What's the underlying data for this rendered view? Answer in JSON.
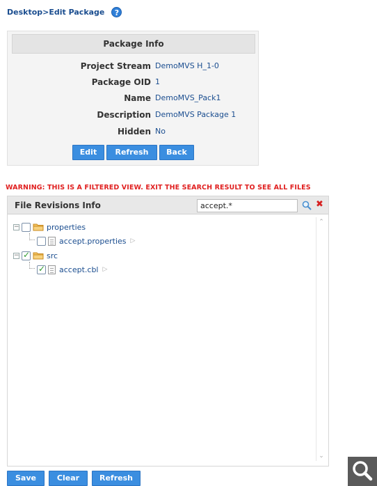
{
  "breadcrumb": "Desktop>Edit Package",
  "help_icon": "?",
  "package_info": {
    "title": "Package Info",
    "rows": [
      {
        "label": "Project Stream",
        "value": "DemoMVS H_1-0"
      },
      {
        "label": "Package OID",
        "value": "1"
      },
      {
        "label": "Name",
        "value": "DemoMVS_Pack1"
      },
      {
        "label": "Description",
        "value": "DemoMVS Package 1"
      },
      {
        "label": "Hidden",
        "value": "No"
      }
    ],
    "buttons": {
      "edit": "Edit",
      "refresh": "Refresh",
      "back": "Back"
    }
  },
  "warning": "WARNING: THIS IS A FILTERED VIEW. EXIT THE SEARCH RESULT TO SEE ALL FILES",
  "file_revisions": {
    "title": "File Revisions Info",
    "search_value": "accept.*",
    "clear_symbol": "✖",
    "tree": [
      {
        "name": "properties",
        "expander": "−",
        "checked": false,
        "children": [
          {
            "name": "accept.properties",
            "checked": false
          }
        ]
      },
      {
        "name": "src",
        "expander": "−",
        "checked": true,
        "children": [
          {
            "name": "accept.cbl",
            "checked": true
          }
        ]
      }
    ]
  },
  "bottom_buttons": {
    "save": "Save",
    "clear": "Clear",
    "refresh": "Refresh"
  },
  "colors": {
    "accent_blue": "#3b8ee0",
    "link_blue": "#1a4d8f",
    "warning_red": "#e02020",
    "folder_orange": "#e8a23a"
  },
  "icons": {
    "help": "help-icon",
    "search": "search-icon",
    "clear": "clear-icon",
    "folder": "folder-icon",
    "file": "file-icon",
    "zoom": "zoom-icon"
  }
}
